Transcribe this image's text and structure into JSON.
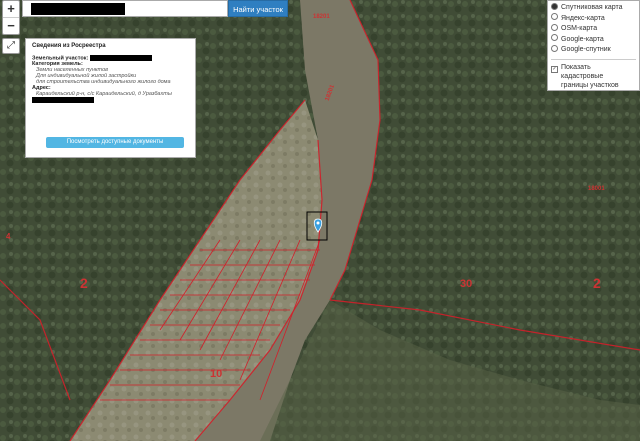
{
  "toolbar": {
    "zoom_in": "+",
    "zoom_out": "−",
    "fullscreen": "⤢",
    "search_button": "Найти участок"
  },
  "info_panel": {
    "title": "Сведения из Росреестра",
    "plot_label": "Земельный участок:",
    "category_label": "Категория земель:",
    "category_value": "Земли населенных пунктов",
    "use_line1": "Для индивидуальной жилой застройки",
    "use_line2": "для строительства индивидуального жилого дома",
    "address_label": "Адрес:",
    "address_value": "Караидельский р-н, с/с Караидельский, д Уразбахты",
    "docs_button": "Посмотреть доступные документы"
  },
  "layers": {
    "options": [
      {
        "label": "Спутниковая карта",
        "selected": true
      },
      {
        "label": "Яндекс-карта",
        "selected": false
      },
      {
        "label": "OSM-карта",
        "selected": false
      },
      {
        "label": "Google-карта",
        "selected": false
      },
      {
        "label": "Google-спутник",
        "selected": false
      }
    ],
    "cadastral_checked": true,
    "cadastral_label_1": "Показать",
    "cadastral_label_2": "кадастровые",
    "cadastral_label_3": "границы участков"
  },
  "map_labels": {
    "zone_left": "2",
    "zone_right": "2",
    "zone_center": "30",
    "zone_village": "10",
    "zone_far_left": "4",
    "road_code_top": "18201",
    "road_code_right": "18001",
    "river_code": "18201"
  }
}
